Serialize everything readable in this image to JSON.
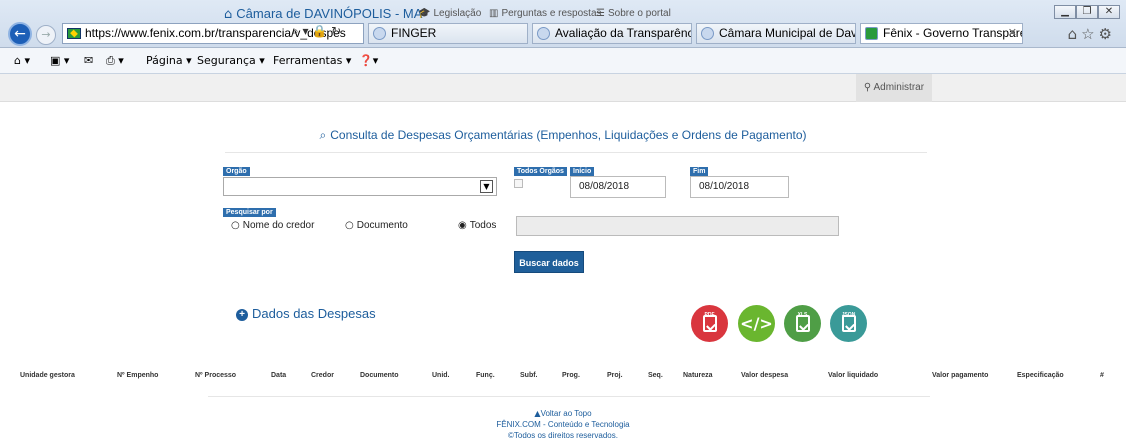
{
  "browser": {
    "url": "https://www.fenix.com.br/transparencia/v_despes",
    "tabs": [
      {
        "label": "FINGER"
      },
      {
        "label": "Avaliação da Transparência do..."
      },
      {
        "label": "Câmara Municipal de Davinóp..."
      },
      {
        "label": "Fênix - Governo Transparen..."
      }
    ],
    "command_bar": {
      "pagina": "Página ▾",
      "seguranca": "Segurança ▾",
      "ferramentas": "Ferramentas ▾"
    }
  },
  "site_nav": {
    "brand": "Câmara de DAVINÓPOLIS - MA",
    "legislacao": "Legislação",
    "perguntas": "Perguntas e respostas",
    "sobre": "Sobre o portal",
    "administrar": "Administrar"
  },
  "page": {
    "title": "Consulta de Despesas Orçamentárias (Empenhos, Liquidações e Ordens de Pagamento)"
  },
  "form": {
    "orgao_label": "Orgão",
    "orgao_value": "",
    "todos_orgaos_label": "Todos Órgãos",
    "inicio_label": "Início",
    "inicio_value": "08/08/2018",
    "fim_label": "Fim",
    "fim_value": "08/10/2018",
    "pesquisar_label": "Pesquisar por",
    "options": [
      "Nome do credor",
      "Documento",
      "Todos"
    ],
    "selected_option": "Todos",
    "search_value": "",
    "buscar_label": "Buscar dados"
  },
  "results": {
    "section_title": "Dados das Despesas",
    "export": {
      "pdf": "PDF",
      "xls": "XLS",
      "json": "JSON",
      "colors": {
        "pdf": "#d9363e",
        "code": "#6ab62f",
        "xls": "#4f9e46",
        "json": "#3a9a98"
      }
    },
    "columns": [
      "Unidade gestora",
      "Nº Empenho",
      "Nº Processo",
      "Data",
      "Credor",
      "Documento",
      "Unid.",
      "Funç.",
      "Subf.",
      "Prog.",
      "Proj.",
      "Seq.",
      "Natureza",
      "Valor despesa",
      "Valor liquidado",
      "Valor pagamento",
      "Especificação",
      "#"
    ]
  },
  "footer": {
    "back_to_top": "Voltar ao Topo",
    "line1": "FÊNIX.COM - Conteúdo e Tecnologia",
    "line2": "©Todos os direitos reservados."
  }
}
